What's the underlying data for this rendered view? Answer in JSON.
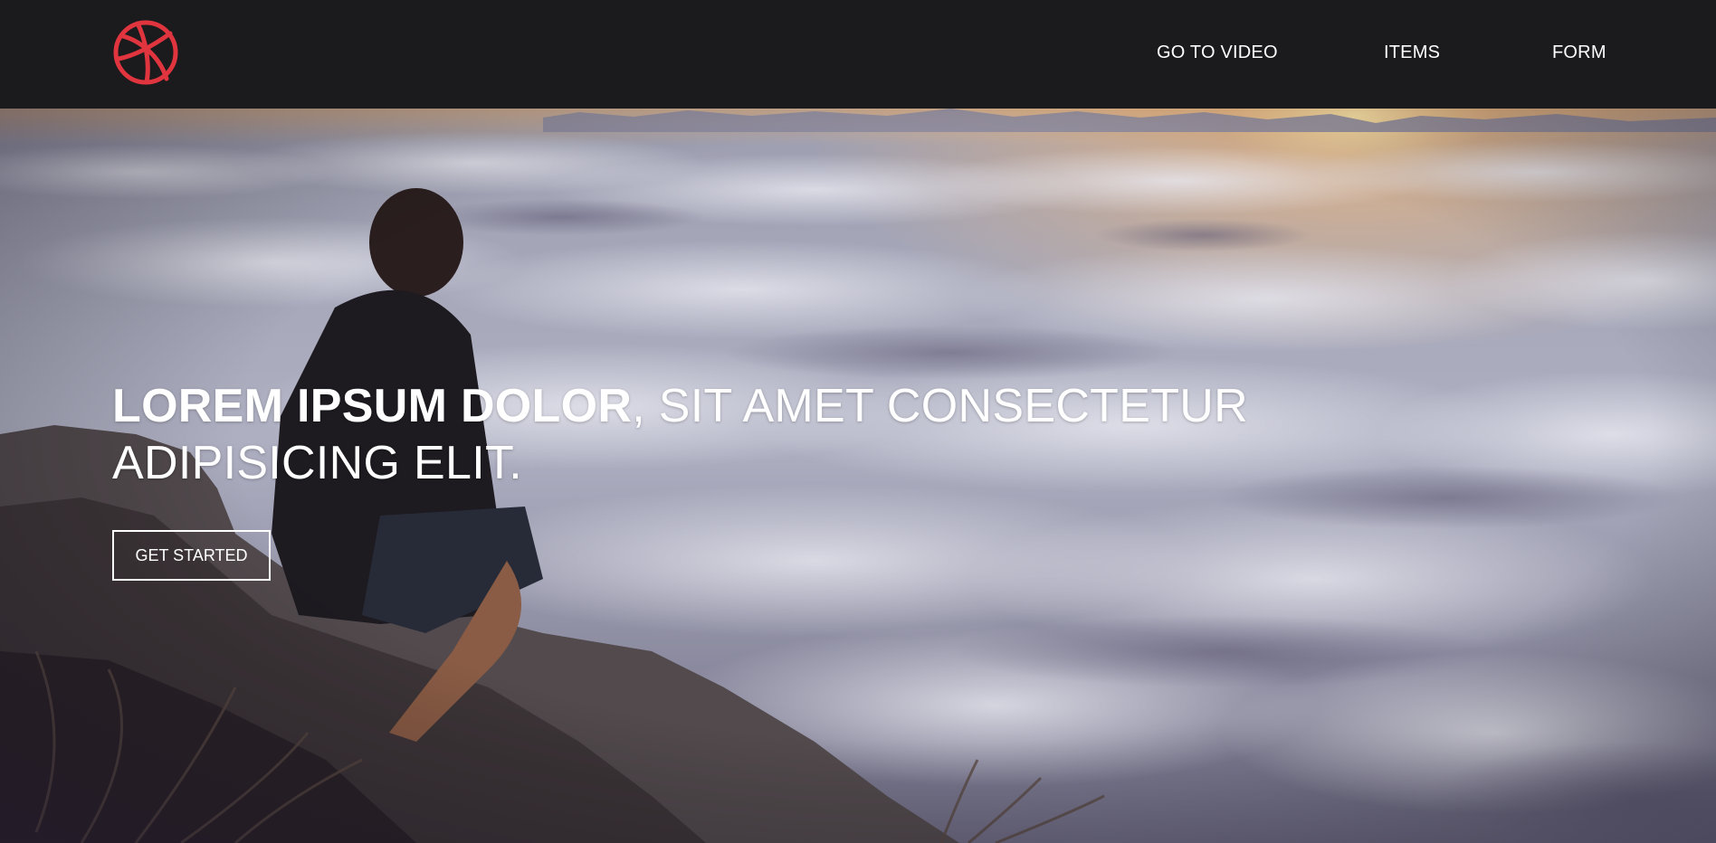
{
  "nav": {
    "logo_icon": "dribbble-ball-icon",
    "logo_color": "#e0353f",
    "links": [
      {
        "label": "GO TO VIDEO"
      },
      {
        "label": "ITEMS"
      },
      {
        "label": "FORM"
      }
    ],
    "background": "#1b1a1c"
  },
  "hero": {
    "headline_bold": "LOREM IPSUM DOLOR",
    "headline_rest": ", SIT AMET CONSECTETUR ADIPISICING ELIT.",
    "cta_label": "GET STARTED"
  }
}
